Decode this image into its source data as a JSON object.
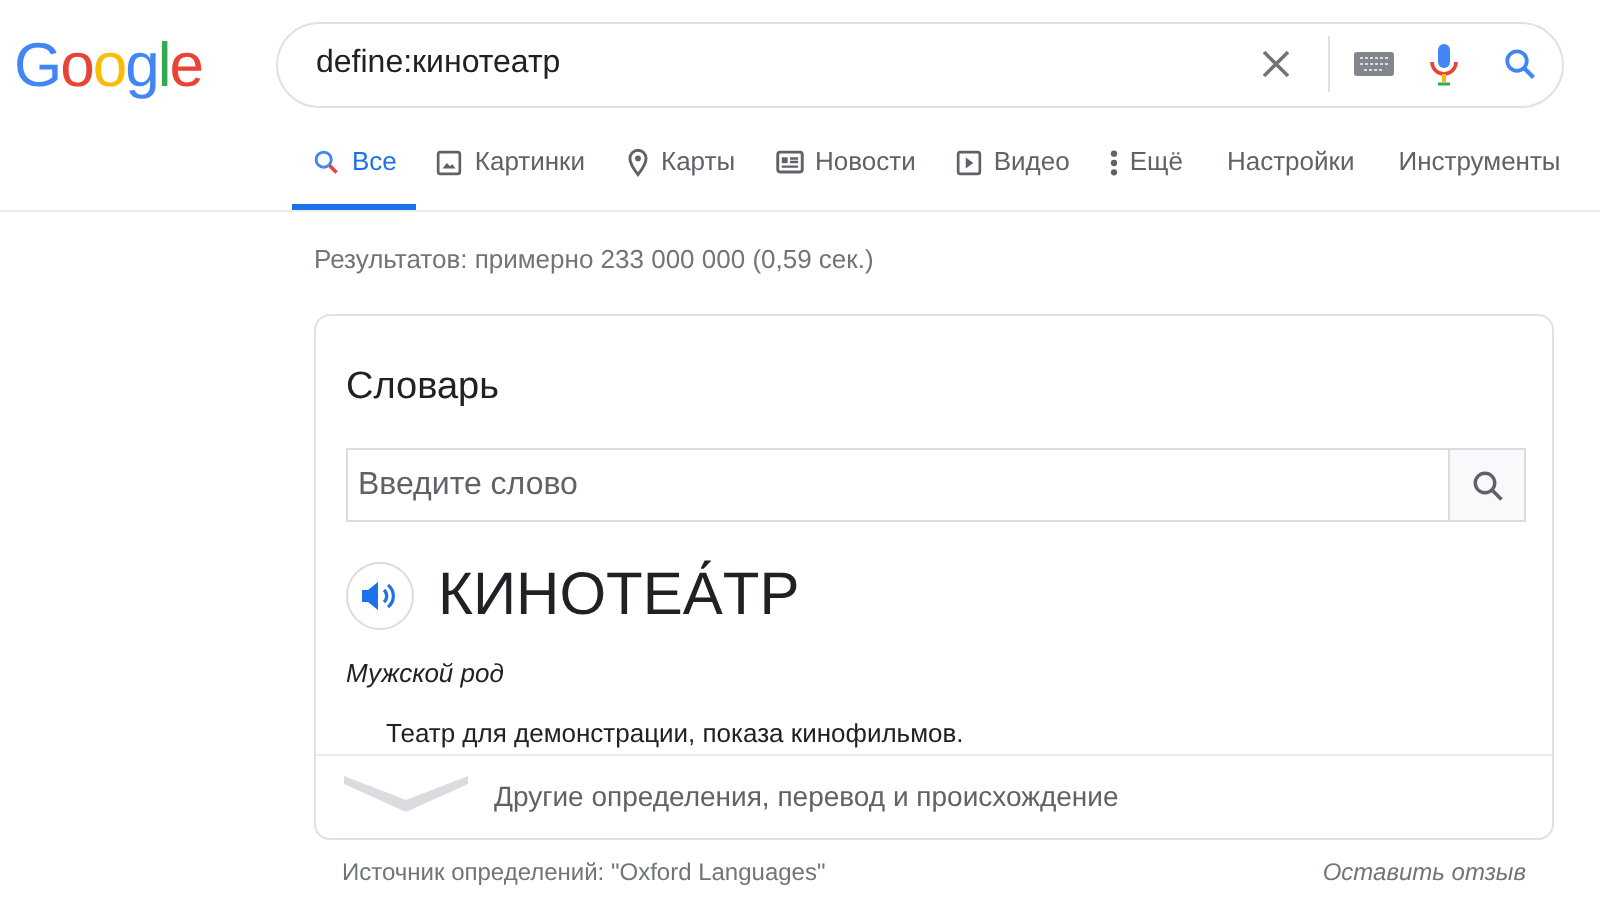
{
  "logo": "Google",
  "search": {
    "value": "define:кинотеатр"
  },
  "tabs": [
    {
      "label": "Все",
      "kind": "search",
      "selected": true
    },
    {
      "label": "Картинки",
      "kind": "images",
      "selected": false
    },
    {
      "label": "Карты",
      "kind": "maps",
      "selected": false
    },
    {
      "label": "Новости",
      "kind": "news",
      "selected": false
    },
    {
      "label": "Видео",
      "kind": "video",
      "selected": false
    },
    {
      "label": "Ещё",
      "kind": "more",
      "selected": false
    },
    {
      "label": "Настройки",
      "kind": "plain",
      "selected": false
    },
    {
      "label": "Инструменты",
      "kind": "plain",
      "selected": false
    }
  ],
  "result_stats": "Результатов: примерно 233 000 000 (0,59 сек.)",
  "dictionary": {
    "title": "Словарь",
    "input_placeholder": "Введите слово",
    "word": "КИНОТЕА́ТР",
    "gender": "Мужской род",
    "definition": "Театр для демонстрации, показа кинофильмов.",
    "more_link": "Другие определения, перевод и происхождение"
  },
  "footer": {
    "source": "Источник определений: \"Oxford Languages\"",
    "feedback": "Оставить отзыв"
  }
}
